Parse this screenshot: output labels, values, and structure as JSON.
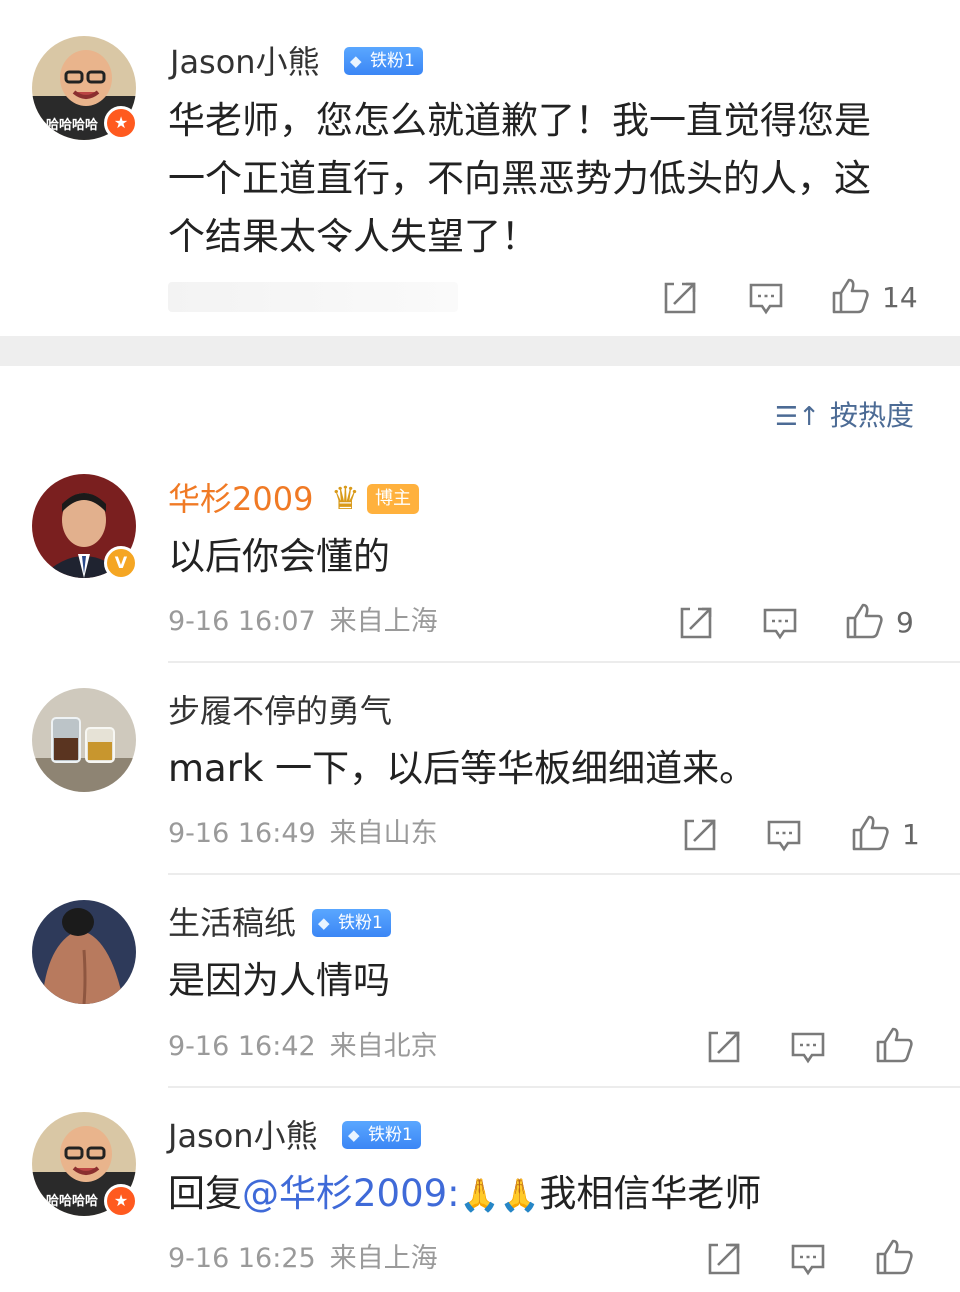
{
  "top_comment": {
    "user": "Jason小熊",
    "fan_badge": "铁粉1",
    "text": "华老师，您怎么就道歉了！我一直觉得您是一个正道直行，不向黑恶势力低头的人，这个结果太令人失望了！",
    "likes": "14",
    "avatar_caption": "哈哈哈哈"
  },
  "sort": {
    "label": "按热度",
    "icon": "sort-icon"
  },
  "comments": [
    {
      "user": "华杉2009",
      "badge": "博主",
      "text": "以后你会懂的",
      "time": "9-16 16:07",
      "location": "来自上海",
      "likes": "9"
    },
    {
      "user": "步履不停的勇气",
      "text": "mark 一下，以后等华板细细道来。",
      "time": "9-16 16:49",
      "location": "来自山东",
      "likes": "1"
    },
    {
      "user": "生活稿纸",
      "fan_badge": "铁粉1",
      "text": "是因为人情吗",
      "time": "9-16 16:42",
      "location": "来自北京",
      "likes": ""
    },
    {
      "user": "Jason小熊",
      "fan_badge": "铁粉1",
      "reply_prefix": "回复",
      "mention": "@华杉2009:",
      "text": "我相信华老师",
      "time": "9-16 16:25",
      "location": "来自上海",
      "likes": "",
      "avatar_caption": "哈哈哈哈"
    }
  ],
  "colors": {
    "orange_name": "#f07a25",
    "blue_badge": "#3b86f5",
    "mention": "#3f6ad8",
    "meta": "#9a9a9a"
  }
}
